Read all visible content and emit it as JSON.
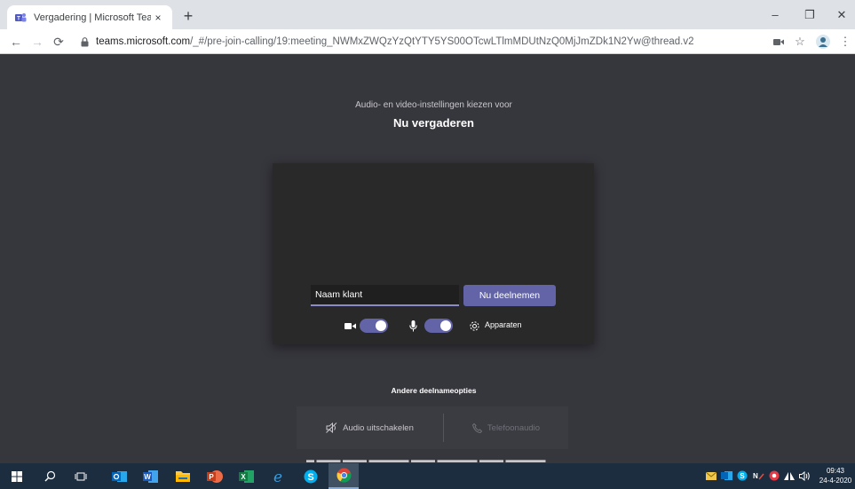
{
  "browser": {
    "tab_title": "Vergadering | Microsoft Teams",
    "tab_close": "×",
    "new_tab": "+",
    "url_host": "teams.microsoft.com",
    "url_path": "/_#/pre-join-calling/19:meeting_NWMxZWQzYzQtYTY5YS00OTcwLTlmMDUtNzQ0MjJmZDk1N2Yw@thread.v2",
    "window_controls": {
      "minimize": "–",
      "restore": "❐",
      "close": "✕"
    }
  },
  "prejoin": {
    "subtitle": "Audio- en video-instellingen kiezen voor",
    "heading": "Nu vergaderen",
    "name_value": "Naam klant",
    "join_label": "Nu deelnemen",
    "devices_label": "Apparaten",
    "camera_on": true,
    "mic_on": true
  },
  "other_options": {
    "title": "Andere deelnameopties",
    "audio_off_label": "Audio uitschakelen",
    "phone_audio_label": "Telefoonaudio"
  },
  "taskbar": {
    "time": "09:43",
    "date": "24-4-2020"
  },
  "colors": {
    "background": "#36363d",
    "accent": "#6264a7",
    "taskbar": "#1c2d3f"
  }
}
